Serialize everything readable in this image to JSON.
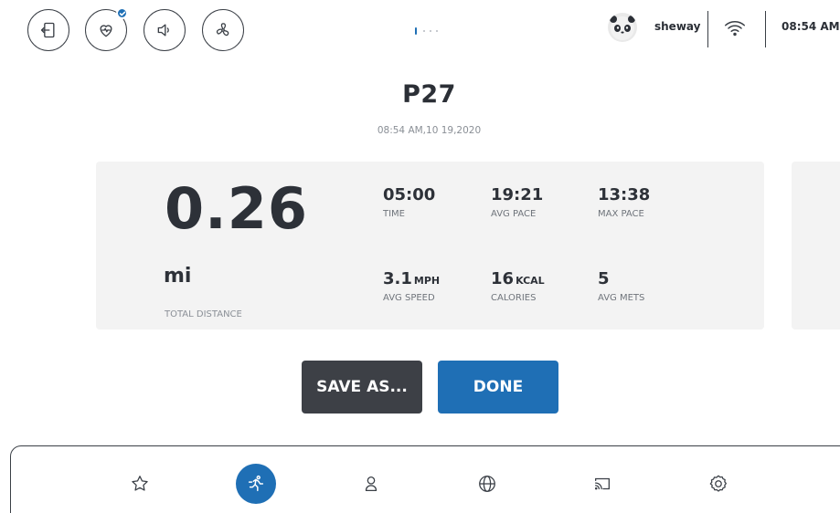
{
  "topbar": {
    "buttons": [
      {
        "name": "exit-button",
        "icon": "exit-icon"
      },
      {
        "name": "heart-rate-button",
        "icon": "heart-rate-icon",
        "badge": "check-icon"
      },
      {
        "name": "volume-button",
        "icon": "speaker-icon"
      },
      {
        "name": "fan-button",
        "icon": "fan-icon"
      }
    ],
    "pager": {
      "pages": 4,
      "active": 1
    },
    "user": {
      "name": "sheway",
      "avatar_icon": "panda-avatar"
    },
    "wifi_icon": "wifi-icon",
    "time": "08:54 AM"
  },
  "header": {
    "title": "P27",
    "subtitle": "08:54 AM,10 19,2020"
  },
  "summary": {
    "distance": {
      "value": "0.26",
      "unit": "mi",
      "label": "TOTAL DISTANCE"
    },
    "stats": [
      {
        "value": "05:00",
        "unit": "",
        "label": "TIME"
      },
      {
        "value": "19:21",
        "unit": "",
        "label": "AVG PACE"
      },
      {
        "value": "13:38",
        "unit": "",
        "label": "MAX PACE"
      },
      {
        "value": "3.1",
        "unit": "MPH",
        "label": "AVG SPEED"
      },
      {
        "value": "16",
        "unit": "KCAL",
        "label": "CALORIES"
      },
      {
        "value": "5",
        "unit": "",
        "label": "AVG METS"
      }
    ]
  },
  "actions": {
    "save_label": "SAVE AS...",
    "done_label": "DONE"
  },
  "bottom_nav": [
    {
      "icon": "star-icon",
      "active": false
    },
    {
      "icon": "running-icon",
      "active": true
    },
    {
      "icon": "location-pin-icon",
      "active": false
    },
    {
      "icon": "globe-icon",
      "active": false
    },
    {
      "icon": "cast-icon",
      "active": false
    },
    {
      "icon": "gear-icon",
      "active": false
    }
  ],
  "colors": {
    "accent": "#1f6fb5",
    "dark_button": "#3d4046",
    "card_bg": "#f3f3f3",
    "text": "#2d3138",
    "muted": "#8a8f96"
  }
}
